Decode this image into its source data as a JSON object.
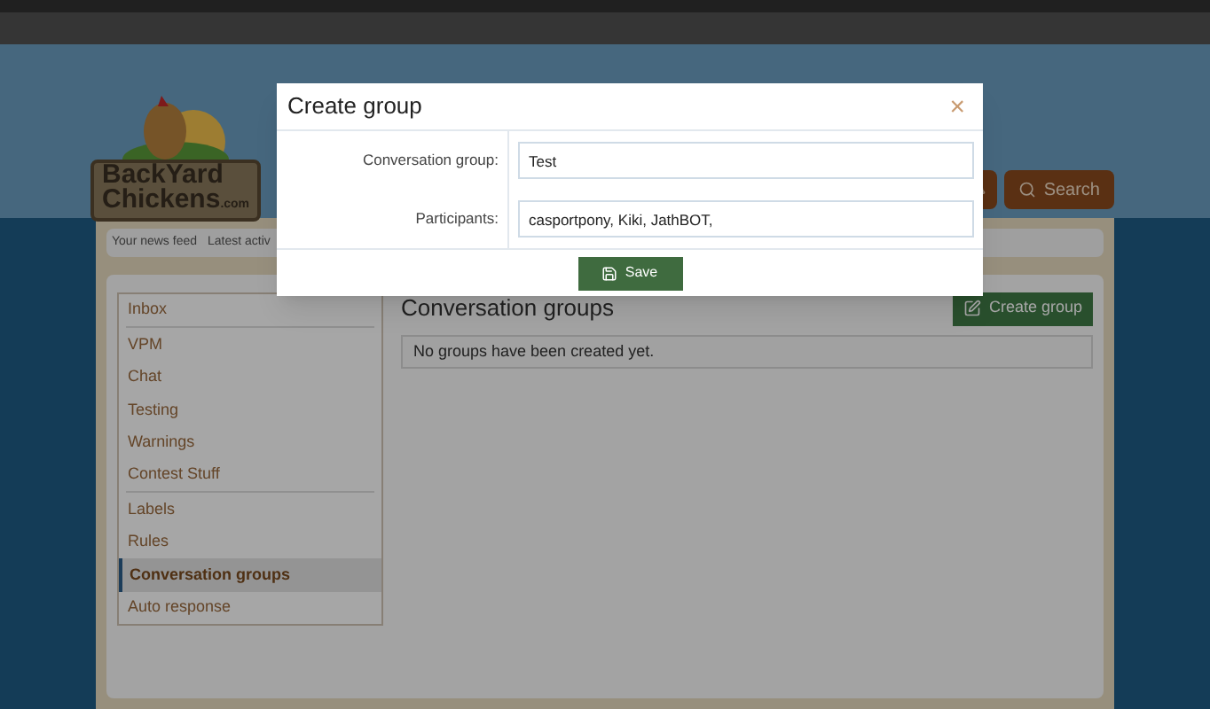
{
  "header": {
    "logo_line_1": "BackYard",
    "logo_line_2": "Chickens",
    "logo_suffix": ".com",
    "search_label": "Search"
  },
  "nav": {
    "items": [
      "Your news feed",
      "Latest activ"
    ]
  },
  "sidebar": {
    "groups": [
      [
        {
          "label": "Inbox",
          "selected": false
        }
      ],
      [
        {
          "label": "VPM",
          "selected": false
        },
        {
          "label": "Chat",
          "selected": false
        },
        {
          "label": "Testing",
          "selected": false
        },
        {
          "label": "Warnings",
          "selected": false
        },
        {
          "label": "Contest Stuff",
          "selected": false
        }
      ],
      [
        {
          "label": "Labels",
          "selected": false
        },
        {
          "label": "Rules",
          "selected": false
        },
        {
          "label": "Conversation groups",
          "selected": true
        },
        {
          "label": "Auto response",
          "selected": false
        }
      ]
    ]
  },
  "content": {
    "title": "Conversation groups",
    "create_button": "Create group",
    "empty_message": "No groups have been created yet."
  },
  "modal": {
    "title": "Create group",
    "close": "×",
    "fields": [
      {
        "label": "Conversation group:",
        "value": "Test"
      },
      {
        "label": "Participants:",
        "value": "casportpony, Kiki, JathBOT,"
      }
    ],
    "save_button": "Save"
  }
}
